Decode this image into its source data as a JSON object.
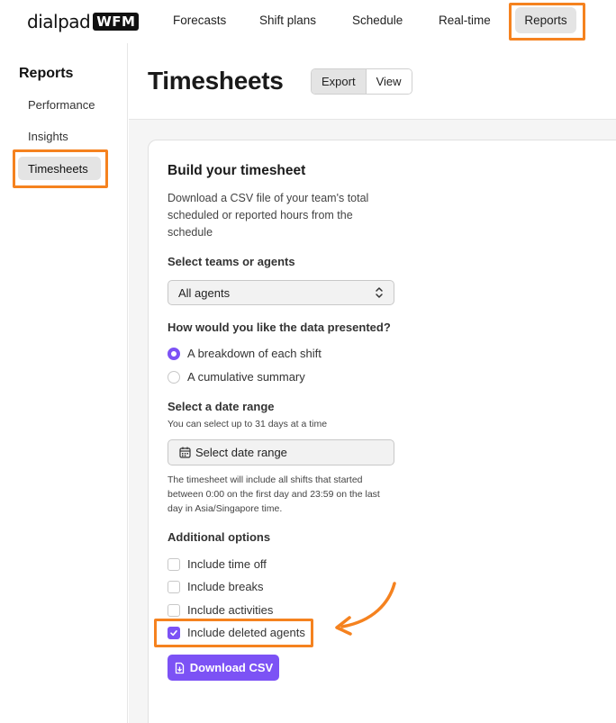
{
  "app": {
    "logo_text": "dialpad",
    "logo_badge": "WFM"
  },
  "nav": {
    "items": [
      "Forecasts",
      "Shift plans",
      "Schedule",
      "Real-time",
      "Reports"
    ],
    "active": "Reports"
  },
  "sidebar": {
    "title": "Reports",
    "items": [
      "Performance",
      "Insights",
      "Timesheets"
    ],
    "active": "Timesheets"
  },
  "page": {
    "title": "Timesheets",
    "toggle": [
      "Export",
      "View"
    ],
    "toggle_active": "Export"
  },
  "card": {
    "title": "Build your timesheet",
    "description": "Download a CSV file of your team's total scheduled or reported hours from the schedule",
    "teams_label": "Select teams or agents",
    "teams_value": "All agents",
    "presentation_label": "How would you like the data presented?",
    "presentation_options": [
      "A breakdown of each shift",
      "A cumulative summary"
    ],
    "presentation_selected": "A breakdown of each shift",
    "date_label": "Select a date range",
    "date_hint": "You can select up to 31 days at a time",
    "date_button": "Select date range",
    "date_note": "The timesheet will include all shifts that started between 0:00 on the first day and 23:59 on the last day in Asia/Singapore time.",
    "options_label": "Additional options",
    "options": [
      {
        "label": "Include time off",
        "checked": false
      },
      {
        "label": "Include breaks",
        "checked": false
      },
      {
        "label": "Include activities",
        "checked": false
      },
      {
        "label": "Include deleted agents",
        "checked": true
      }
    ],
    "download_button": "Download CSV"
  },
  "colors": {
    "accent": "#7c52f5",
    "highlight": "#f5821f",
    "active_bg": "#e4e4e4"
  },
  "icons": [
    "chevron-updown-icon",
    "calendar-icon",
    "download-icon",
    "check-icon",
    "arrow-annotation-icon"
  ]
}
